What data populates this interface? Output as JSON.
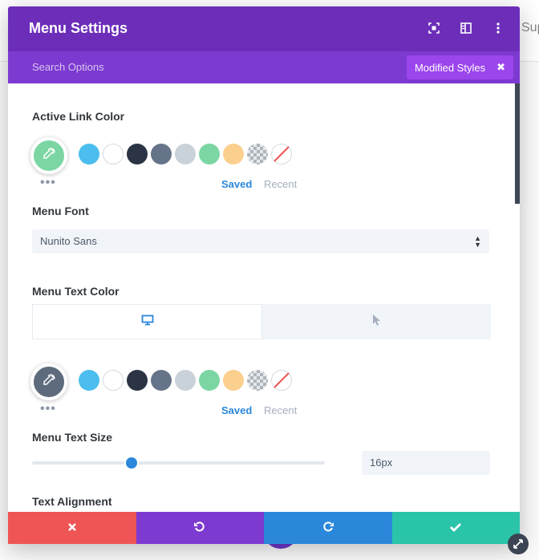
{
  "background": {
    "partial_text": "Sup"
  },
  "modal": {
    "title": "Menu Settings",
    "header_icons": [
      "expand-icon",
      "sidebar-layout-icon",
      "kebab-menu-icon"
    ],
    "search_placeholder": "Search Options",
    "modified_badge": "Modified Styles",
    "modified_badge_close": "✖"
  },
  "active_link_color": {
    "label": "Active Link Color",
    "current_color": "#7cd6a3",
    "tabs": {
      "saved": "Saved",
      "recent": "Recent"
    }
  },
  "menu_font": {
    "label": "Menu Font",
    "value": "Nunito Sans"
  },
  "menu_text_color": {
    "label": "Menu Text Color",
    "current_color": "#5d6b7c",
    "device_tabs": [
      "desktop-icon",
      "hover-cursor-icon"
    ],
    "tabs": {
      "saved": "Saved",
      "recent": "Recent"
    }
  },
  "swatches": [
    "#4bbdee",
    "#ffffff",
    "#2a3444",
    "#66748a",
    "#c9d1d9",
    "#7cd6a3",
    "#fbcf8e",
    "transparent",
    "none"
  ],
  "menu_text_size": {
    "label": "Menu Text Size",
    "value": "16px",
    "slider_fraction": 0.34
  },
  "text_alignment": {
    "label": "Text Alignment"
  },
  "footer": {
    "buttons": [
      {
        "name": "cancel-button",
        "icon": "close-icon",
        "color": "#ef5555"
      },
      {
        "name": "undo-button",
        "icon": "undo-icon",
        "color": "#7d3ad0"
      },
      {
        "name": "redo-button",
        "icon": "redo-icon",
        "color": "#2b87da"
      },
      {
        "name": "save-button",
        "icon": "check-icon",
        "color": "#29c4a9"
      }
    ]
  }
}
